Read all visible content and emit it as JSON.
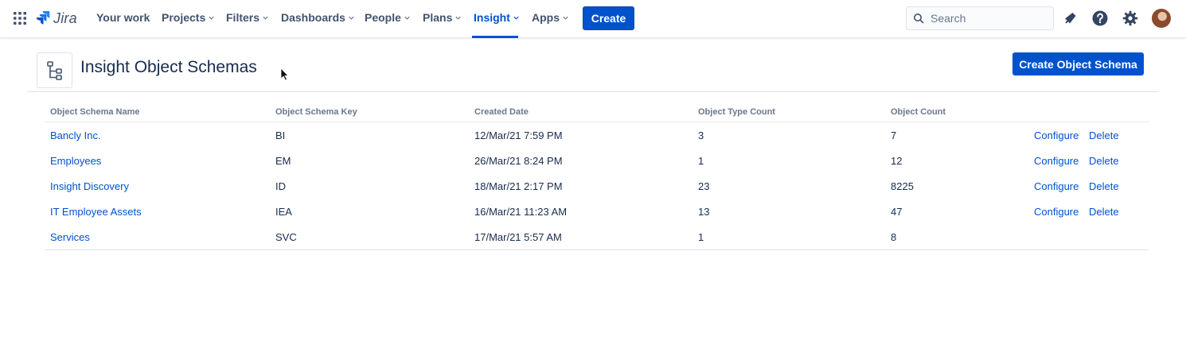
{
  "nav": {
    "product_name": "Jira",
    "items": [
      {
        "label": "Your work",
        "dropdown": false
      },
      {
        "label": "Projects",
        "dropdown": true
      },
      {
        "label": "Filters",
        "dropdown": true
      },
      {
        "label": "Dashboards",
        "dropdown": true
      },
      {
        "label": "People",
        "dropdown": true
      },
      {
        "label": "Plans",
        "dropdown": true
      },
      {
        "label": "Insight",
        "dropdown": true,
        "active": true
      },
      {
        "label": "Apps",
        "dropdown": true
      }
    ],
    "create_label": "Create",
    "search_placeholder": "Search",
    "icons": [
      "app-switcher-icon",
      "notifications-icon",
      "help-icon",
      "settings-icon",
      "avatar"
    ]
  },
  "page": {
    "title": "Insight Object Schemas",
    "create_button_label": "Create Object Schema",
    "icon": "schema-tree-icon"
  },
  "table": {
    "columns": [
      "Object Schema Name",
      "Object Schema Key",
      "Created Date",
      "Object Type Count",
      "Object Count"
    ],
    "rows": [
      {
        "name": "Bancly Inc.",
        "key": "BI",
        "created": "12/Mar/21 7:59 PM",
        "type_count": "3",
        "object_count": "7",
        "configure": "Configure",
        "delete": "Delete"
      },
      {
        "name": "Employees",
        "key": "EM",
        "created": "26/Mar/21 8:24 PM",
        "type_count": "1",
        "object_count": "12",
        "configure": "Configure",
        "delete": "Delete"
      },
      {
        "name": "Insight Discovery",
        "key": "ID",
        "created": "18/Mar/21 2:17 PM",
        "type_count": "23",
        "object_count": "8225",
        "configure": "Configure",
        "delete": "Delete"
      },
      {
        "name": "IT Employee Assets",
        "key": "IEA",
        "created": "16/Mar/21 11:23 AM",
        "type_count": "13",
        "object_count": "47",
        "configure": "Configure",
        "delete": "Delete"
      },
      {
        "name": "Services",
        "key": "SVC",
        "created": "17/Mar/21 5:57 AM",
        "type_count": "1",
        "object_count": "8",
        "configure": "",
        "delete": ""
      }
    ]
  },
  "colors": {
    "brand_blue": "#0052cc",
    "text": "#172b4d",
    "muted": "#6b778c"
  }
}
